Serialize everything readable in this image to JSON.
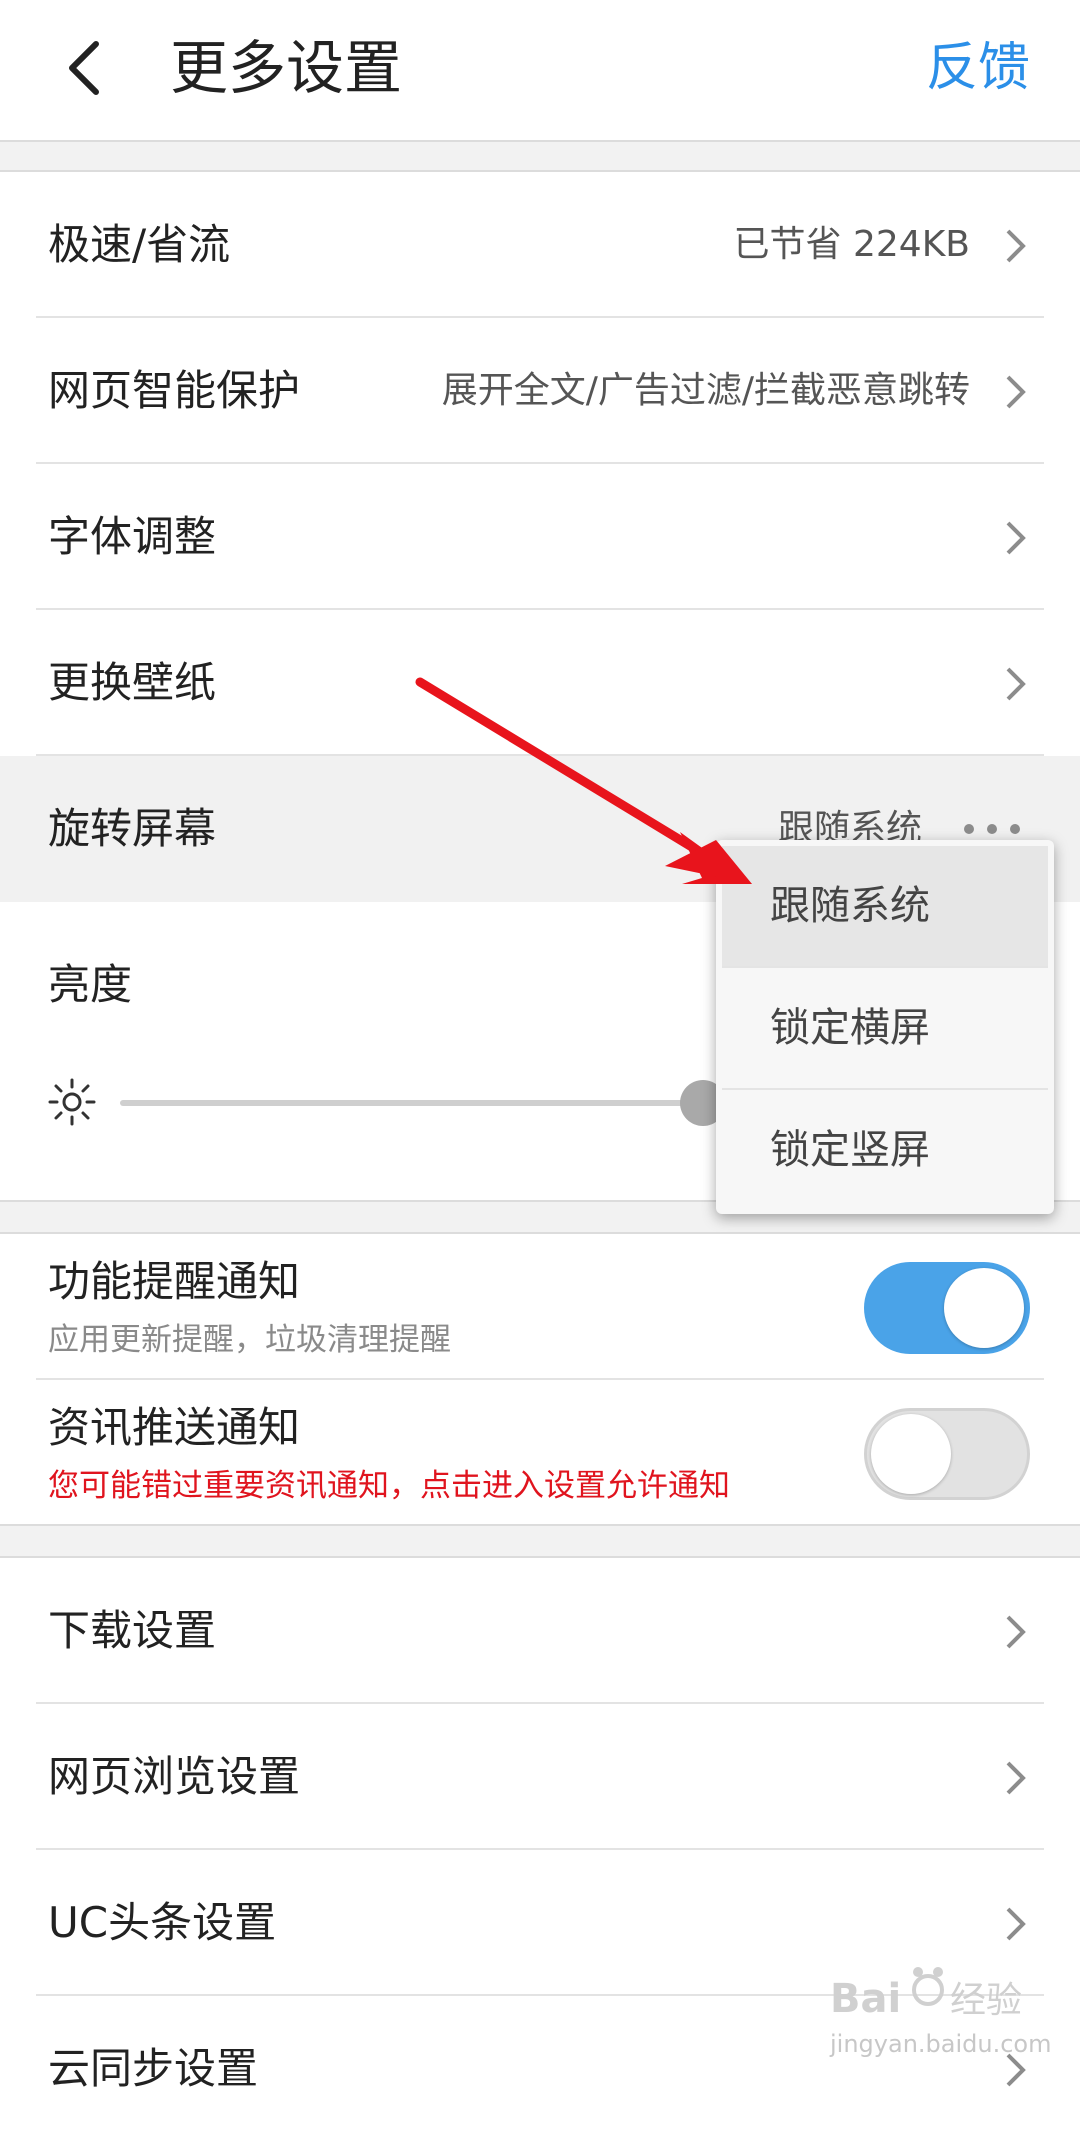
{
  "header": {
    "title": "更多设置",
    "feedback": "反馈"
  },
  "settings_group1": [
    {
      "label": "极速/省流",
      "value": "已节省 224KB"
    },
    {
      "label": "网页智能保护",
      "value": "展开全文/广告过滤/拦截恶意跳转"
    },
    {
      "label": "字体调整",
      "value": ""
    },
    {
      "label": "更换壁纸",
      "value": ""
    },
    {
      "label": "旋转屏幕",
      "value": "跟随系统"
    }
  ],
  "brightness": {
    "label": "亮度",
    "level": 0.74
  },
  "rotation_menu": {
    "options": [
      "跟随系统",
      "锁定横屏",
      "锁定竖屏"
    ],
    "selected": "跟随系统"
  },
  "notifications": [
    {
      "title": "功能提醒通知",
      "subtitle": "应用更新提醒，垃圾清理提醒",
      "enabled": true
    },
    {
      "title": "资讯推送通知",
      "subtitle": "您可能错过重要资讯通知，点击进入设置允许通知",
      "enabled": false
    }
  ],
  "settings_group2": [
    {
      "label": "下载设置"
    },
    {
      "label": "网页浏览设置"
    },
    {
      "label": "UC头条设置"
    },
    {
      "label": "云同步设置"
    }
  ],
  "watermark": {
    "text": "jingyan.baidu.com",
    "logo": "Bai 经验"
  },
  "colors": {
    "accent": "#2b8fe8",
    "toggle_on": "#4aa3e8",
    "warning": "#e0141e",
    "arrow": "#e8141c"
  }
}
